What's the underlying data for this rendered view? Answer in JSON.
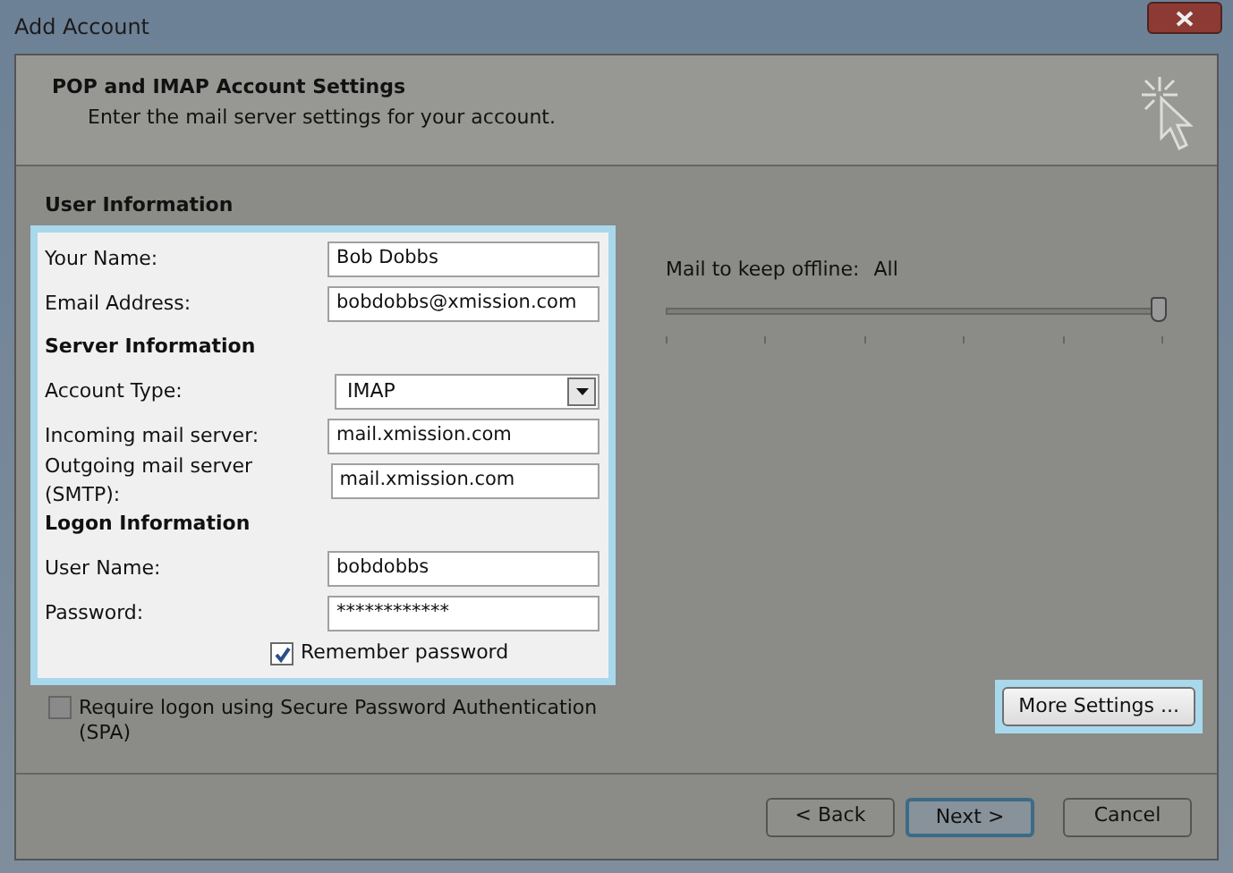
{
  "window": {
    "title": "Add Account"
  },
  "header": {
    "title": "POP and IMAP Account Settings",
    "subtitle": "Enter the mail server settings for your account."
  },
  "user_information_heading": "User Information",
  "fields": [
    {
      "kind": "text",
      "label": "Your Name:",
      "value": "Bob Dobbs"
    },
    {
      "kind": "text",
      "label": "Email Address:",
      "value": "bobdobbs@xmission.com"
    },
    {
      "kind": "heading",
      "label": "Server Information"
    },
    {
      "kind": "select",
      "label": "Account Type:",
      "value": "IMAP"
    },
    {
      "kind": "text",
      "label": "Incoming mail server:",
      "value": "mail.xmission.com"
    },
    {
      "kind": "text",
      "label": "Outgoing mail server (SMTP):",
      "value": "mail.xmission.com"
    },
    {
      "kind": "heading",
      "label": "Logon Information"
    },
    {
      "kind": "text",
      "label": "User Name:",
      "value": "bobdobbs"
    },
    {
      "kind": "password",
      "label": "Password:",
      "value": "************"
    },
    {
      "kind": "checkbox",
      "label": "Remember password",
      "checked": true
    }
  ],
  "spa": {
    "label": "Require logon using Secure Password Authentication (SPA)",
    "checked": false
  },
  "offline": {
    "label": "Mail to keep offline:",
    "value": "All",
    "level": 1.0
  },
  "more_settings": "More Settings ...",
  "buttons": [
    {
      "label": "< Back",
      "default": false
    },
    {
      "label": "Next >",
      "default": true
    },
    {
      "label": "Cancel",
      "default": false
    }
  ]
}
